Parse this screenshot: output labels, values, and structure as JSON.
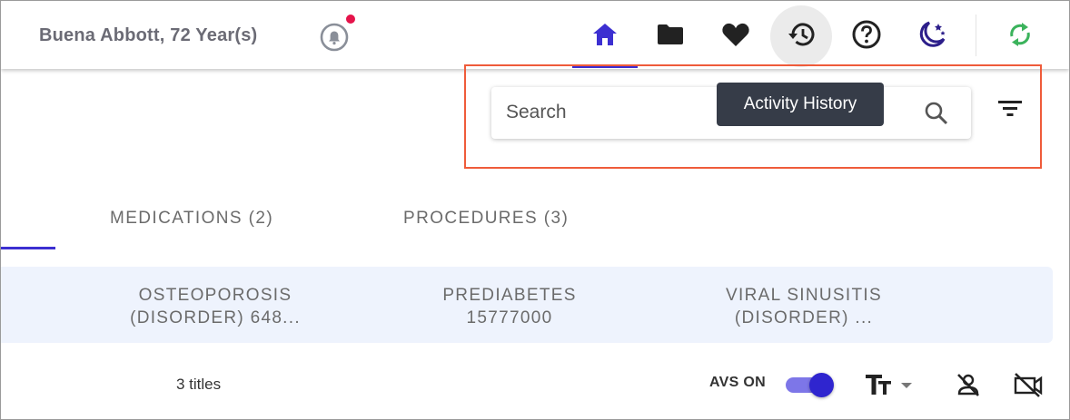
{
  "header": {
    "patient_name": "Buena Abbott, 72 Year(s)",
    "nav": [
      {
        "name": "home-icon",
        "color": "#3c2fd1"
      },
      {
        "name": "folder-icon",
        "color": "#222222"
      },
      {
        "name": "heart-icon",
        "color": "#222222"
      },
      {
        "name": "history-icon",
        "color": "#222222"
      },
      {
        "name": "help-icon",
        "color": "#222222"
      },
      {
        "name": "dark-mode-icon",
        "color": "#2c1e8a"
      },
      {
        "name": "sync-icon",
        "color": "#3bb35c"
      }
    ]
  },
  "search": {
    "placeholder": "Search",
    "tooltip": "Activity History"
  },
  "tabs": [
    {
      "label": "MEDICATIONS (2)"
    },
    {
      "label": "PROCEDURES (3)"
    }
  ],
  "chips": [
    {
      "line1": "OSTEOPOROSIS",
      "line2": "(DISORDER) 648..."
    },
    {
      "line1": "PREDIABETES",
      "line2": "15777000"
    },
    {
      "line1": "VIRAL SINUSITIS",
      "line2": "(DISORDER) ..."
    }
  ],
  "footer": {
    "titles_count": "3 titles",
    "avs_label": "AVS ON",
    "avs_on": true
  },
  "colors": {
    "accent": "#3c2fd1",
    "highlight_border": "#ef5b3a",
    "notification_dot": "#e5134a",
    "tooltip_bg": "#363c48",
    "chips_bg": "#eef3fd"
  }
}
